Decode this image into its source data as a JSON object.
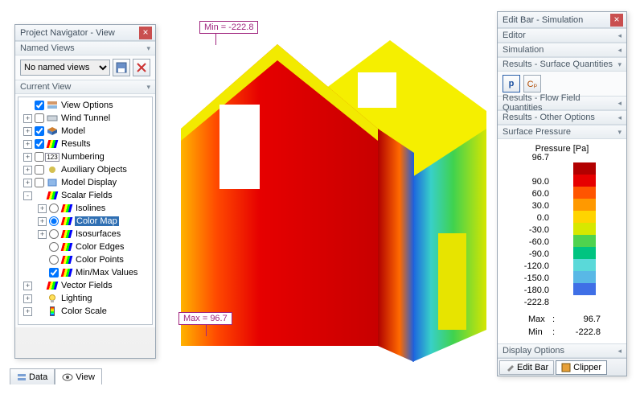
{
  "navigator": {
    "title": "Project Navigator - View",
    "named_views_hd": "Named Views",
    "named_views_value": "No named views",
    "current_view_hd": "Current View",
    "tree": [
      {
        "d": 0,
        "exp": "",
        "chk": true,
        "icon": "layers",
        "label": "View Options"
      },
      {
        "d": 0,
        "exp": "+",
        "chk": false,
        "icon": "tunnel",
        "label": "Wind Tunnel"
      },
      {
        "d": 0,
        "exp": "+",
        "chk": true,
        "icon": "model",
        "label": "Model"
      },
      {
        "d": 0,
        "exp": "+",
        "chk": true,
        "icon": "stripe",
        "label": "Results"
      },
      {
        "d": 0,
        "exp": "+",
        "chk": false,
        "icon": "num",
        "label": "Numbering"
      },
      {
        "d": 0,
        "exp": "+",
        "chk": false,
        "icon": "aux",
        "label": "Auxiliary Objects"
      },
      {
        "d": 0,
        "exp": "+",
        "chk": false,
        "icon": "mdisp",
        "label": "Model Display"
      },
      {
        "d": 0,
        "exp": "-",
        "chk": "",
        "icon": "stripe",
        "label": "Scalar Fields"
      },
      {
        "d": 1,
        "exp": "+",
        "rdo": false,
        "icon": "stripe",
        "label": "Isolines"
      },
      {
        "d": 1,
        "exp": "+",
        "rdo": true,
        "icon": "stripe",
        "label": "Color Map",
        "sel": true
      },
      {
        "d": 1,
        "exp": "+",
        "rdo": false,
        "icon": "stripe",
        "label": "Isosurfaces"
      },
      {
        "d": 1,
        "exp": "",
        "rdo": false,
        "icon": "stripe",
        "label": "Color Edges"
      },
      {
        "d": 1,
        "exp": "",
        "rdo": false,
        "icon": "stripe",
        "label": "Color Points"
      },
      {
        "d": 1,
        "exp": "",
        "chk": true,
        "icon": "stripe",
        "label": "Min/Max Values"
      },
      {
        "d": 0,
        "exp": "+",
        "chk": "",
        "icon": "stripe",
        "label": "Vector Fields"
      },
      {
        "d": 0,
        "exp": "+",
        "chk": "",
        "icon": "bulb",
        "label": "Lighting"
      },
      {
        "d": 0,
        "exp": "+",
        "chk": "",
        "icon": "scale",
        "label": "Color Scale"
      }
    ],
    "tabs": {
      "data": "Data",
      "view": "View"
    }
  },
  "annotations": {
    "min": "Min = -222.8",
    "max": "Max = 96.7"
  },
  "editbar": {
    "title": "Edit Bar - Simulation",
    "sections": {
      "editor": "Editor",
      "simulation": "Simulation",
      "surface": "Results - Surface Quantities",
      "flow": "Results - Flow Field Quantities",
      "other": "Results - Other Options",
      "sp": "Surface Pressure",
      "display": "Display Options"
    },
    "btn_p": "p",
    "btn_cp": "Cₚ",
    "legend_title": "Pressure [Pa]",
    "legend": [
      {
        "c": "#b20000",
        "v": "96.7"
      },
      {
        "c": "#e60000",
        "v": "90.0"
      },
      {
        "c": "#ff5500",
        "v": "60.0"
      },
      {
        "c": "#ff9900",
        "v": "30.0"
      },
      {
        "c": "#ffd400",
        "v": "0.0"
      },
      {
        "c": "#d7e800",
        "v": "-30.0"
      },
      {
        "c": "#4fd34f",
        "v": "-60.0"
      },
      {
        "c": "#00c481",
        "v": "-90.0"
      },
      {
        "c": "#5ad9d9",
        "v": "-120.0"
      },
      {
        "c": "#59b8e6",
        "v": "-150.0"
      },
      {
        "c": "#3f6fe6",
        "v": "-180.0"
      },
      {
        "c": "#1a1ae6",
        "v": "-222.8"
      }
    ],
    "max_label": "Max",
    "max_val": "96.7",
    "min_label": "Min",
    "min_val": "-222.8",
    "tabs": {
      "editbar": "Edit Bar",
      "clipper": "Clipper"
    }
  },
  "chart_data": {
    "type": "table",
    "title": "Pressure [Pa]",
    "series": [
      {
        "name": "Surface Pressure",
        "values": [
          96.7,
          90.0,
          60.0,
          30.0,
          0.0,
          -30.0,
          -60.0,
          -90.0,
          -120.0,
          -150.0,
          -180.0,
          -222.8
        ]
      }
    ],
    "max": 96.7,
    "min": -222.8
  }
}
